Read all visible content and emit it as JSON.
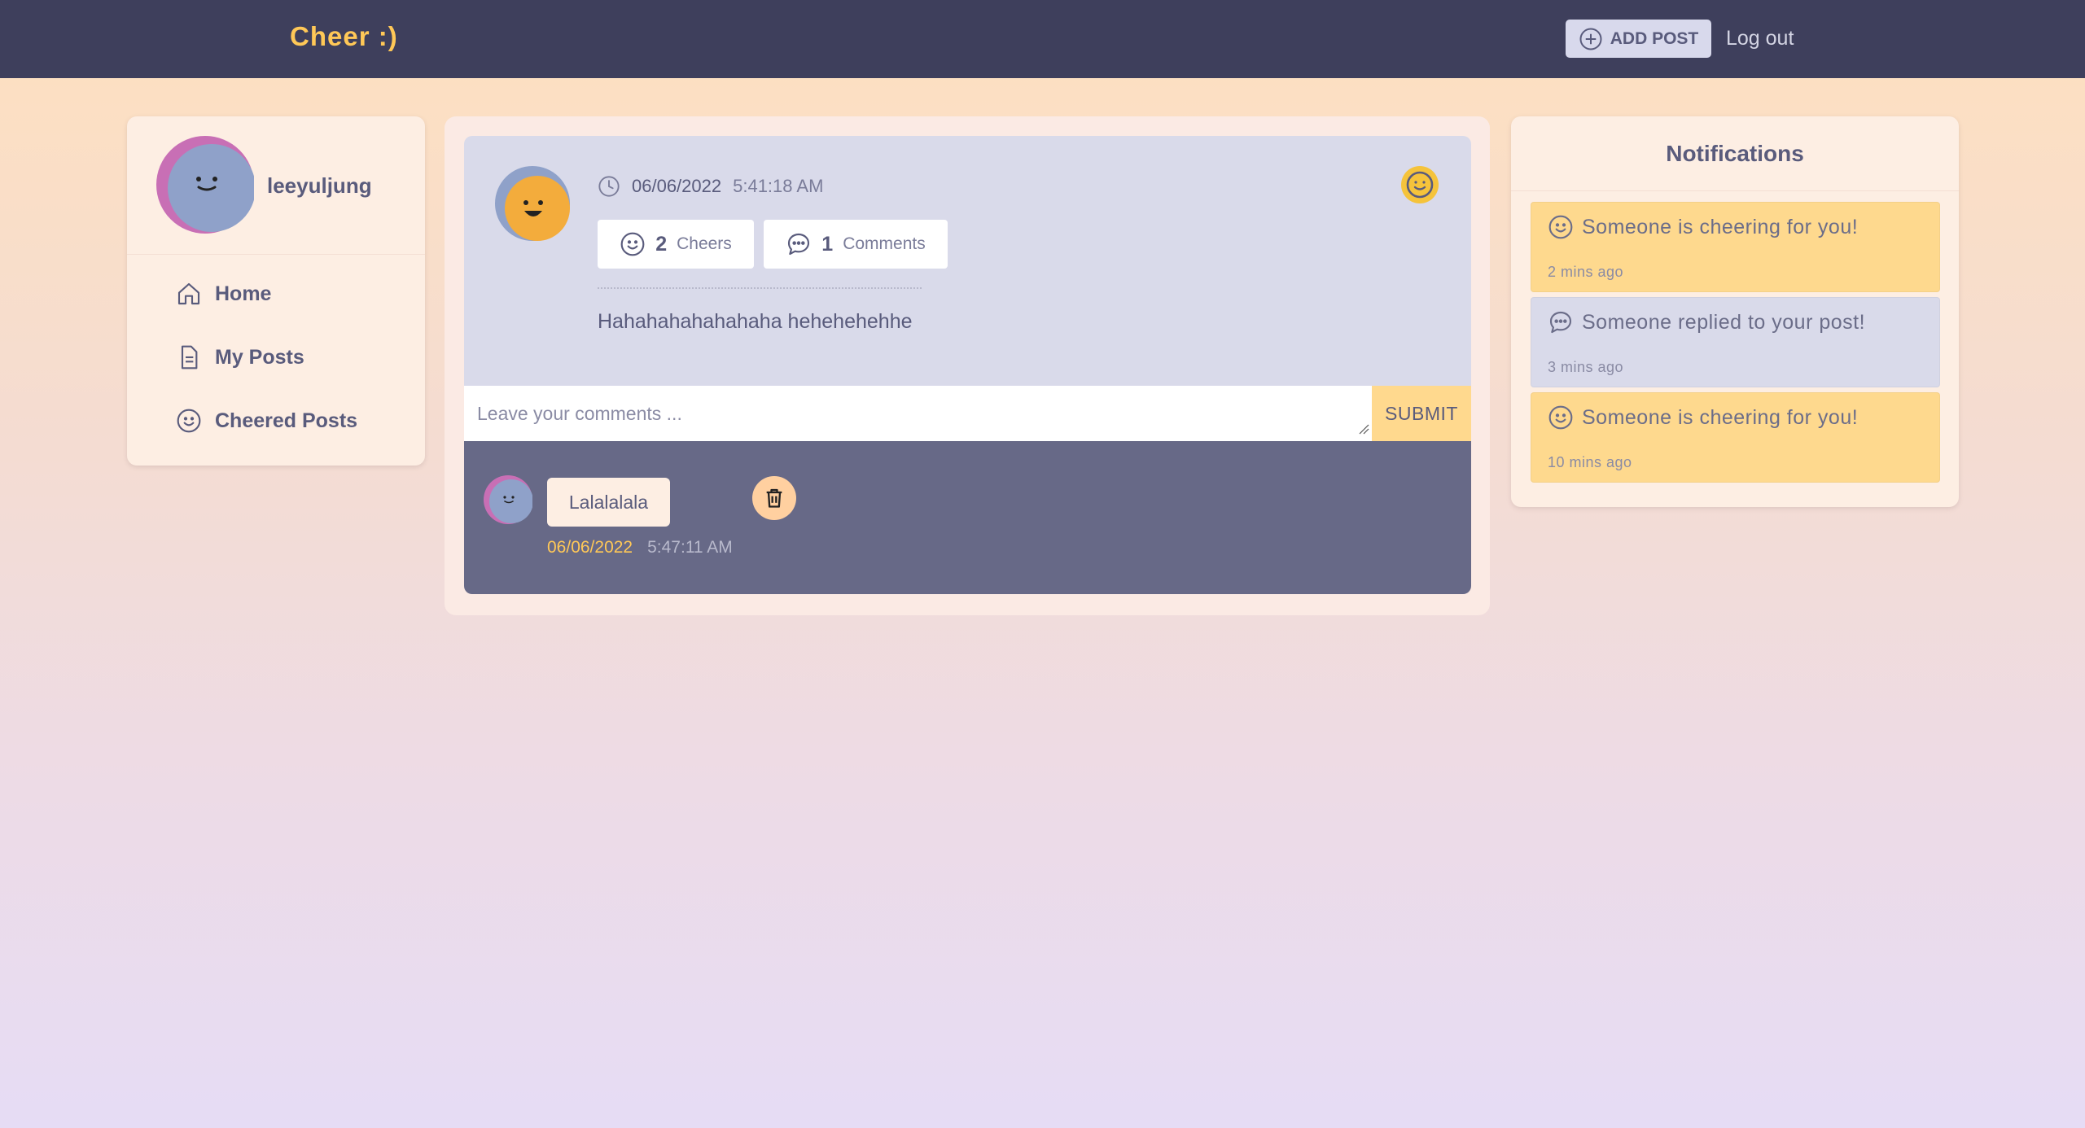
{
  "header": {
    "brand": "Cheer :)",
    "add_post_label": "ADD POST",
    "logout_label": "Log out"
  },
  "sidebar": {
    "username": "leeyuljung",
    "items": [
      {
        "label": "Home",
        "icon": "home-icon"
      },
      {
        "label": "My Posts",
        "icon": "document-icon"
      },
      {
        "label": "Cheered Posts",
        "icon": "smiley-icon"
      }
    ]
  },
  "post": {
    "date": "06/06/2022",
    "time": "5:41:18 AM",
    "cheers_count": "2",
    "cheers_label": "Cheers",
    "comments_count": "1",
    "comments_label": "Comments",
    "text": "Hahahahahahahaha hehehehehhe",
    "comment_placeholder": "Leave your comments ...",
    "submit_label": "SUBMIT",
    "comments": [
      {
        "text": "Lalalalala",
        "date": "06/06/2022",
        "time": "5:47:11 AM"
      }
    ]
  },
  "notifications": {
    "title": "Notifications",
    "items": [
      {
        "message": "Someone is cheering for you!",
        "ago": "2 mins ago",
        "type": "cheer",
        "icon": "smiley-icon"
      },
      {
        "message": "Someone replied to your post!",
        "ago": "3 mins ago",
        "type": "reply",
        "icon": "chat-bubble-icon"
      },
      {
        "message": "Someone is cheering for you!",
        "ago": "10 mins ago",
        "type": "cheer",
        "icon": "smiley-icon"
      }
    ]
  },
  "colors": {
    "topbar": "#3e3f5c",
    "brand": "#ffc857",
    "text": "#595b7c",
    "cheer_notif": "#fed98e",
    "reply_notif": "#d9daea",
    "comment_area": "#676987"
  }
}
